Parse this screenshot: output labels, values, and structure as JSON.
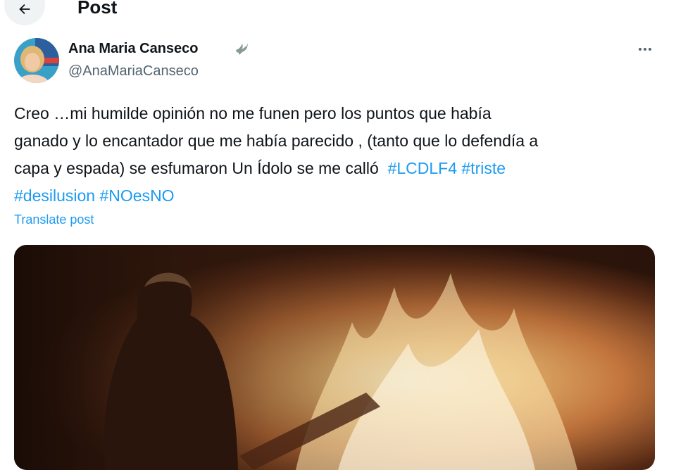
{
  "header": {
    "title": "Post",
    "back_icon": "arrow-left-icon"
  },
  "author": {
    "display_name": "Ana Maria Canseco",
    "handle": "@AnaMariaCanseco",
    "badge_icon": "dove-icon",
    "more_icon": "more-horizontal-icon"
  },
  "post": {
    "text_parts": [
      "Creo …mi humilde opinión no me funen pero los puntos que había\nganado y lo encantador que me había parecido , (tanto que lo defendía a\ncapa y espada) se esfumaron Un Ídolo se me calló  ",
      "#LCDLF4",
      " ",
      "#triste",
      "\n",
      "#desilusion",
      " ",
      "#NOesNO"
    ],
    "translate_label": "Translate post"
  },
  "colors": {
    "link": "#1d9bf0",
    "secondary_text": "#536471",
    "primary_text": "#0f1419"
  }
}
